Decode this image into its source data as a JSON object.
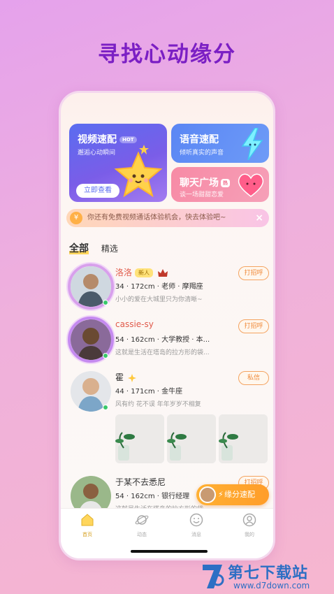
{
  "headline": "寻找心动缘分",
  "cards": {
    "video": {
      "title": "视频速配",
      "badge": "HOT",
      "subtitle": "邂逅心动瞬间",
      "button": "立即查看"
    },
    "voice": {
      "title": "语音速配",
      "subtitle": "倾听真实的声音"
    },
    "chat": {
      "title": "聊天广场",
      "badge": "热",
      "subtitle": "谈一场甜甜恋爱"
    }
  },
  "notice": {
    "text": "你还有免费视频通话体验机会，快去体验吧~"
  },
  "tabs": [
    "全部",
    "精选"
  ],
  "users": [
    {
      "name": "洛洛",
      "badge": "新人",
      "meta": "34 · 172cm · 老师 · 摩羯座",
      "desc": "小小的爱在大城里只为你清晰~",
      "action": "打招呼"
    },
    {
      "name": "cassie-sy",
      "meta": "54 · 162cm · 大学教授 · 本...",
      "desc": "这就是生活在塔岛的拉方形的袋...",
      "action": "打招呼"
    },
    {
      "name": "霍",
      "meta": "44 · 171cm · 金牛座",
      "desc": "风有约 花不误 年年岁岁不相复",
      "action": "私信"
    },
    {
      "name": "于某不去悉尼",
      "meta": "54 · 162cm · 银行经理",
      "desc": "这就是生活在塔岛的拉方形的袋...",
      "action": "打招呼"
    }
  ],
  "speed_match": "缘分速配",
  "nav": [
    "首页",
    "动态",
    "消息",
    "我的"
  ],
  "watermark": {
    "title": "第七下载站",
    "url": "www.d7down.com"
  }
}
